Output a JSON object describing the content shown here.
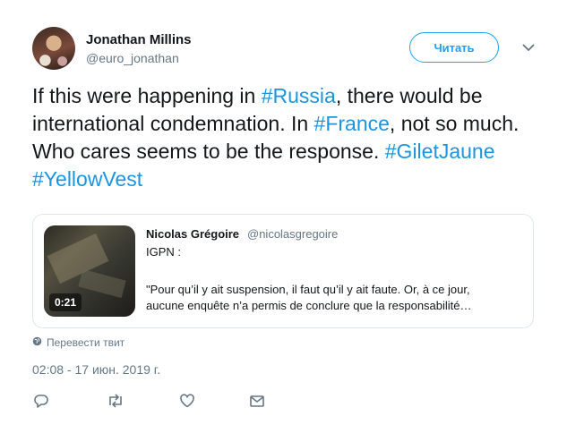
{
  "author": {
    "name": "Jonathan Millins",
    "handle": "@euro_jonathan",
    "avatar_icon": "avatar-photo"
  },
  "follow_button": {
    "label": "Читать",
    "color": "#1da1f2"
  },
  "caret_icon": "chevron-down-icon",
  "tweet": {
    "segments": [
      {
        "text": "If this were happening in ",
        "hashtag": false
      },
      {
        "text": "#Russia",
        "hashtag": true
      },
      {
        "text": ", there would be international condemnation. In ",
        "hashtag": false
      },
      {
        "text": "#France",
        "hashtag": true
      },
      {
        "text": ", not so much. Who cares seems to be the response. ",
        "hashtag": false
      },
      {
        "text": "#GiletJaune",
        "hashtag": true
      },
      {
        "text": " ",
        "hashtag": false
      },
      {
        "text": "#YellowVest",
        "hashtag": true
      }
    ],
    "hashtag_color": "#1b95e0"
  },
  "quoted": {
    "name": "Nicolas Grégoire",
    "handle": "@nicolasgregoire",
    "line1": "IGPN :",
    "line2": "\"Pour qu’il y ait suspension, il faut qu’il y ait faute. Or, à ce jour,",
    "line3": "aucune enquête n’a permis de conclure que la responsabilité…",
    "video_duration": "0:21"
  },
  "translate": {
    "label": "Перевести твит",
    "icon": "globe-icon"
  },
  "timestamp": "02:08 - 17 июн. 2019 г.",
  "actions": [
    {
      "name": "reply-icon"
    },
    {
      "name": "retweet-icon"
    },
    {
      "name": "like-icon"
    },
    {
      "name": "message-icon"
    }
  ]
}
